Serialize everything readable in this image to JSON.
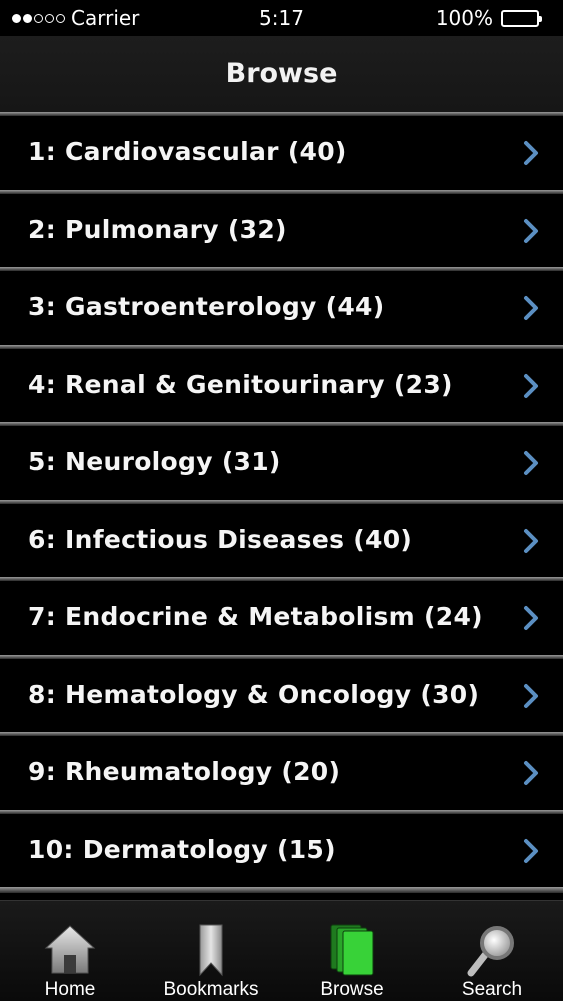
{
  "status_bar": {
    "carrier": "Carrier",
    "time": "5:17",
    "battery": "100%",
    "battery_color": "#4cd964"
  },
  "navbar": {
    "title": "Browse"
  },
  "list": {
    "items": [
      {
        "label": "1: Cardiovascular (40)"
      },
      {
        "label": "2: Pulmonary (32)"
      },
      {
        "label": "3: Gastroenterology (44)"
      },
      {
        "label": "4: Renal & Genitourinary (23)"
      },
      {
        "label": "5: Neurology (31)"
      },
      {
        "label": "6: Infectious Diseases (40)"
      },
      {
        "label": "7: Endocrine & Metabolism (24)"
      },
      {
        "label": "8: Hematology & Oncology (30)"
      },
      {
        "label": "9: Rheumatology (20)"
      },
      {
        "label": "10: Dermatology (15)"
      }
    ],
    "chevron_color": "#5b8fc2"
  },
  "tabbar": {
    "tabs": [
      {
        "label": "Home",
        "icon": "home-icon"
      },
      {
        "label": "Bookmarks",
        "icon": "bookmark-icon"
      },
      {
        "label": "Browse",
        "icon": "books-icon",
        "selected": true
      },
      {
        "label": "Search",
        "icon": "magnifier-icon"
      }
    ]
  }
}
